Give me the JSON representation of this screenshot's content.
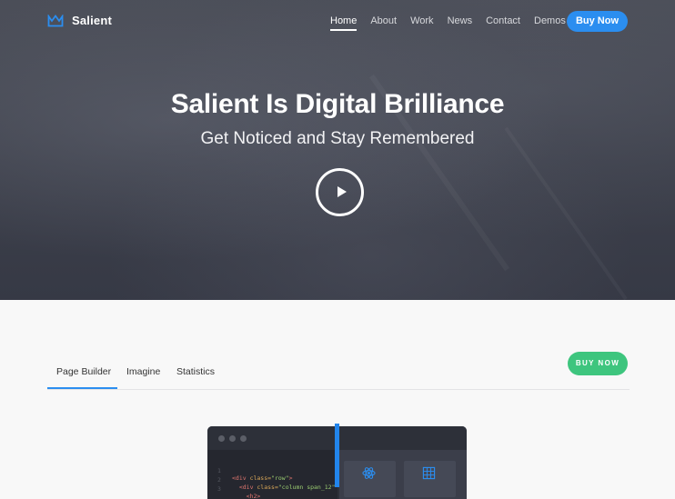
{
  "brand": {
    "name": "Salient",
    "logo_icon": "crown-icon",
    "accent": "#2b8ef0"
  },
  "nav": {
    "items": [
      {
        "label": "Home",
        "active": true
      },
      {
        "label": "About",
        "active": false
      },
      {
        "label": "Work",
        "active": false
      },
      {
        "label": "News",
        "active": false
      },
      {
        "label": "Contact",
        "active": false
      },
      {
        "label": "Demos",
        "active": false
      }
    ],
    "cta": "Buy Now"
  },
  "hero": {
    "title": "Salient Is Digital Brilliance",
    "subtitle": "Get Noticed and Stay Remembered",
    "play_icon": "play-icon"
  },
  "section": {
    "tabs": [
      {
        "label": "Page Builder",
        "active": true
      },
      {
        "label": "Imagine",
        "active": false
      },
      {
        "label": "Statistics",
        "active": false
      }
    ],
    "cta": "BUY NOW",
    "cta_color": "#3ec57e"
  },
  "editor": {
    "lines": [
      {
        "num": "1",
        "indent": "",
        "open": "<div",
        "attr": " class=",
        "str": "\"row\"",
        "close": ">"
      },
      {
        "num": "2",
        "indent": "  ",
        "open": "<div",
        "attr": " class=",
        "str": "\"column span_12\"",
        "close": ""
      },
      {
        "num": "3",
        "indent": "    ",
        "open": "<h2>",
        "attr": "",
        "str": "",
        "close": ""
      }
    ],
    "cards": [
      {
        "icon": "atom-icon"
      },
      {
        "icon": "grid-icon"
      }
    ]
  }
}
